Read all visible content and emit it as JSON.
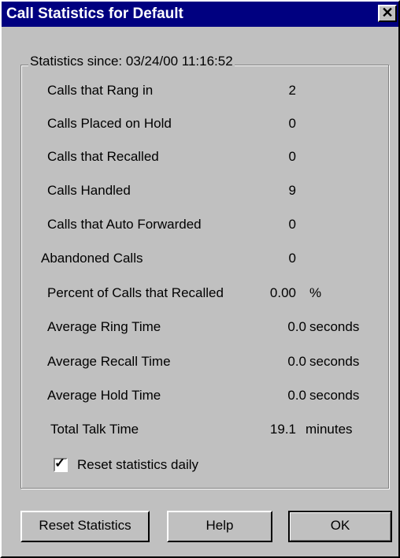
{
  "window": {
    "title": "Call Statistics for Default",
    "close_label": "✕"
  },
  "group": {
    "legend": "Statistics since: 03/24/00 11:16:52"
  },
  "stats": [
    {
      "label": "Calls that Rang in",
      "value": "2",
      "unit": ""
    },
    {
      "label": "Calls Placed on Hold",
      "value": "0",
      "unit": ""
    },
    {
      "label": "Calls that Recalled",
      "value": "0",
      "unit": ""
    },
    {
      "label": "Calls Handled",
      "value": "9",
      "unit": ""
    },
    {
      "label": "Calls that Auto Forwarded",
      "value": "0",
      "unit": ""
    },
    {
      "label": "Abandoned Calls",
      "value": "0",
      "unit": ""
    },
    {
      "label": "Percent of Calls that Recalled",
      "value": "0.00",
      "unit": "%"
    },
    {
      "label": "Average Ring Time",
      "value": "0.0",
      "unit": "seconds"
    },
    {
      "label": "Average Recall Time",
      "value": "0.0",
      "unit": "seconds"
    },
    {
      "label": "Average Hold Time",
      "value": "0.0",
      "unit": "seconds"
    },
    {
      "label": "Total Talk Time",
      "value": "19.1",
      "unit": "minutes"
    }
  ],
  "checkbox": {
    "label": "Reset statistics daily",
    "checked": true,
    "mark": "✓"
  },
  "buttons": {
    "reset": "Reset Statistics",
    "help": "Help",
    "ok": "OK"
  }
}
